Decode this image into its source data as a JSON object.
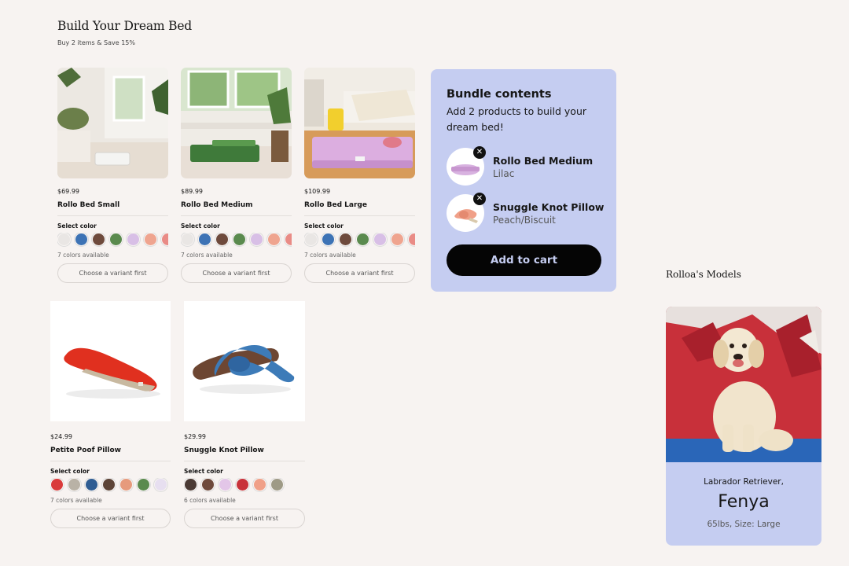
{
  "header": {
    "title": "Build Your Dream Bed",
    "subtitle": "Buy 2 items & Save 15%"
  },
  "products": [
    {
      "price": "$69.99",
      "name": "Rollo Bed Small",
      "select_label": "Select color",
      "colors_available": "7 colors available",
      "button": "Choose a variant first",
      "swatches": [
        "#e9e6e4",
        "#3d73b5",
        "#6e4a3c",
        "#5a8a4e",
        "#d8bfe6",
        "#efa48f",
        "#e98b86"
      ]
    },
    {
      "price": "$89.99",
      "name": "Rollo Bed Medium",
      "select_label": "Select color",
      "colors_available": "7 colors available",
      "button": "Choose a variant first",
      "swatches": [
        "#e9e6e4",
        "#3d73b5",
        "#6e4a3c",
        "#5a8a4e",
        "#d8bfe6",
        "#efa48f",
        "#e98b86"
      ]
    },
    {
      "price": "$109.99",
      "name": "Rollo Bed Large",
      "select_label": "Select color",
      "colors_available": "7 colors available",
      "button": "Choose a variant first",
      "swatches": [
        "#e9e6e4",
        "#3d73b5",
        "#6e4a3c",
        "#5a8a4e",
        "#d8bfe6",
        "#efa48f",
        "#e98b86"
      ]
    },
    {
      "price": "$24.99",
      "name": "Petite Poof Pillow",
      "select_label": "Select color",
      "colors_available": "7 colors available",
      "button": "Choose a variant first",
      "swatches": [
        "#d93a3a",
        "#b9b2a6",
        "#2f5d93",
        "#5c4437",
        "#e69a7c",
        "#5a8a4e",
        "#e7dff0"
      ]
    },
    {
      "price": "$29.99",
      "name": "Snuggle Knot Pillow",
      "select_label": "Select color",
      "colors_available": "6 colors available",
      "button": "Choose a variant first",
      "swatches": [
        "#4a3a34",
        "#6e4a3c",
        "#e3c6e8",
        "#c8323a",
        "#f0a088",
        "#9e9a86"
      ]
    }
  ],
  "bundle": {
    "title": "Bundle contents",
    "description": "Add 2 products to build your dream bed!",
    "items": [
      {
        "name": "Rollo Bed Medium",
        "variant": "Lilac"
      },
      {
        "name": "Snuggle Knot Pillow",
        "variant": "Peach/Biscuit"
      }
    ],
    "cta": "Add to cart",
    "remove_glyph": "✕"
  },
  "models": {
    "title": "Rolloa's Models",
    "breed": "Labrador Retriever,",
    "name": "Fenya",
    "stats": "65lbs, Size: Large"
  },
  "colors": {
    "bundle_bg": "#c5cdf1",
    "page_bg": "#f7f3f1",
    "cta_bg": "#050505"
  }
}
